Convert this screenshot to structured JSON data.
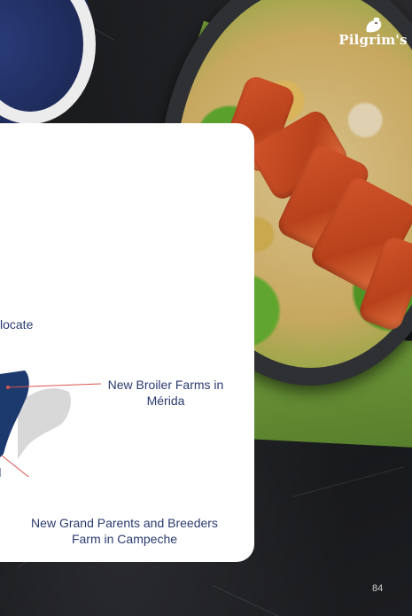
{
  "brand": {
    "logo_text": "Pilgrim's"
  },
  "card": {
    "partial_heading": "locate",
    "callout_broiler": {
      "line1": "New Broiler Farms in",
      "line2": "Mérida"
    },
    "callout_breeders": {
      "line1": "New Grand Parents and Breeders",
      "line2": "Farm in Campeche"
    }
  },
  "page": {
    "number": "84"
  },
  "colors": {
    "text_blue": "#2a3a6e",
    "map_blue": "#1c3a6e",
    "callout_line": "#d9534f",
    "card_bg": "#ffffff"
  }
}
